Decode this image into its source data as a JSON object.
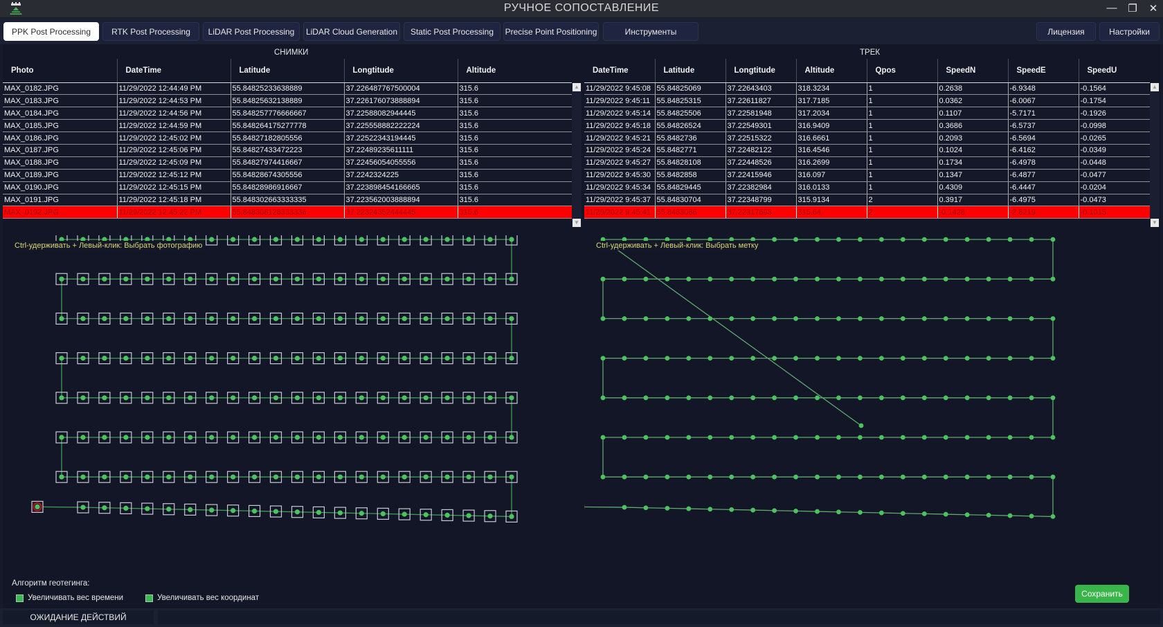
{
  "window": {
    "title": "РУЧНОЕ СОПОСТАВЛЕНИЕ",
    "minimize_icon": "minimize-icon",
    "restore_icon": "restore-icon",
    "close_icon": "close-icon"
  },
  "tabs": [
    {
      "label": "PPK Post Processing",
      "active": true
    },
    {
      "label": "RTK Post Processing",
      "active": false
    },
    {
      "label": "LiDAR Post Processing",
      "active": false
    },
    {
      "label": "LiDAR Cloud Generation",
      "active": false
    },
    {
      "label": "Static Post Processing",
      "active": false
    },
    {
      "label": "Precise Point Positioning",
      "active": false
    },
    {
      "label": "Инструменты",
      "active": false
    }
  ],
  "right_buttons": {
    "license": "Лицензия",
    "settings": "Настройки"
  },
  "photos_table": {
    "title": "СНИМКИ",
    "columns": [
      "Photo",
      "DateTime",
      "Latitude",
      "Longtitude",
      "Altitude"
    ],
    "rows": [
      [
        "MAX_0182.JPG",
        "11/29/2022 12:44:49 PM",
        "55.84825233638889",
        "37.226487767500004",
        "315.6"
      ],
      [
        "MAX_0183.JPG",
        "11/29/2022 12:44:53 PM",
        "55.84825632138889",
        "37.226176073888894",
        "315.6"
      ],
      [
        "MAX_0184.JPG",
        "11/29/2022 12:44:56 PM",
        "55.848257776666667",
        "37.22588082944445",
        "315.6"
      ],
      [
        "MAX_0185.JPG",
        "11/29/2022 12:44:59 PM",
        "55.848264175277778",
        "37.225558882222224",
        "315.6"
      ],
      [
        "MAX_0186.JPG",
        "11/29/2022 12:45:02 PM",
        "55.84827182805556",
        "37.22522343194445",
        "315.6"
      ],
      [
        "MAX_0187.JPG",
        "11/29/2022 12:45:06 PM",
        "55.84827433472223",
        "37.22489235611111",
        "315.6"
      ],
      [
        "MAX_0188.JPG",
        "11/29/2022 12:45:09 PM",
        "55.84827974416667",
        "37.22456054055556",
        "315.6"
      ],
      [
        "MAX_0189.JPG",
        "11/29/2022 12:45:12 PM",
        "55.84828674305556",
        "37.2242324225",
        "315.6"
      ],
      [
        "MAX_0190.JPG",
        "11/29/2022 12:45:15 PM",
        "55.84828986916667",
        "37.223898454166665",
        "315.6"
      ],
      [
        "MAX_0191.JPG",
        "11/29/2022 12:45:18 PM",
        "55.848302663333335",
        "37.223562003888894",
        "315.6"
      ],
      [
        "MAX_0192.JPG",
        "11/29/2022 12:45:22 PM",
        "55.848308128333336",
        "37.22324352444445",
        "315.6"
      ]
    ],
    "selected_row": 10
  },
  "track_table": {
    "title": "ТРЕК",
    "columns": [
      "DateTime",
      "Latitude",
      "Longtitude",
      "Altitude",
      "Qpos",
      "SpeedN",
      "SpeedE",
      "SpeedU"
    ],
    "rows": [
      [
        "11/29/2022 9:45:08",
        "55.84825069",
        "37.22643403",
        "318.3234",
        "1",
        "0.2638",
        "-6.9348",
        "-0.1564"
      ],
      [
        "11/29/2022 9:45:11",
        "55.84825315",
        "37.22611827",
        "317.7185",
        "1",
        "0.0362",
        "-6.0067",
        "-0.1754"
      ],
      [
        "11/29/2022 9:45:14",
        "55.84825506",
        "37.22581948",
        "317.2034",
        "1",
        "0.1107",
        "-5.7171",
        "-0.1926"
      ],
      [
        "11/29/2022 9:45:18",
        "55.84826524",
        "37.22549301",
        "316.9409",
        "1",
        "0.3686",
        "-6.5737",
        "-0.0998"
      ],
      [
        "11/29/2022 9:45:21",
        "55.8482736",
        "37.22515322",
        "316.6661",
        "1",
        "0.2093",
        "-6.5694",
        "-0.0265"
      ],
      [
        "11/29/2022 9:45:24",
        "55.8482771",
        "37.22482122",
        "316.4546",
        "1",
        "0.1024",
        "-6.4162",
        "-0.0349"
      ],
      [
        "11/29/2022 9:45:27",
        "55.84828108",
        "37.22448526",
        "316.2699",
        "1",
        "0.1734",
        "-6.4978",
        "-0.0448"
      ],
      [
        "11/29/2022 9:45:30",
        "55.8482858",
        "37.22415946",
        "316.097",
        "1",
        "0.1347",
        "-6.4877",
        "-0.0477"
      ],
      [
        "11/29/2022 9:45:34",
        "55.84829445",
        "37.22382984",
        "316.0133",
        "1",
        "0.4309",
        "-6.4447",
        "-0.0204"
      ],
      [
        "11/29/2022 9:45:37",
        "55.84830704",
        "37.22348799",
        "315.9134",
        "2",
        "0.3917",
        "-6.4975",
        "-0.0473"
      ],
      [
        "11/29/2022 9:45:41",
        "55.8483086",
        "37.22317693",
        "315.64",
        "2",
        "-0.1428",
        "-2.8219",
        "-0.1015"
      ]
    ],
    "selected_row": 10
  },
  "photo_map": {
    "hint": "Ctrl-удерживать + Левый-клик: Выбрать фотографию",
    "lines": 8,
    "points_per_line": 22,
    "marker_color": "#4cc35e",
    "line_color": "#3f9a52",
    "frame_color": "#c9c9d6",
    "selected_color": "#b3212b"
  },
  "track_map": {
    "hint": "Ctrl-удерживать + Левый-клик: Выбрать метку",
    "lines": 8,
    "points_per_line": 22,
    "marker_color": "#4cc35e",
    "line_color": "#5fa86e",
    "selected_color": "#b3212b"
  },
  "geotag": {
    "label": "Алгоритм геотегинга:",
    "options": [
      {
        "label": "Увеличивать вес времени",
        "checked": true
      },
      {
        "label": "Увеличивать вес координат",
        "checked": true
      }
    ]
  },
  "save_label": "Сохранить",
  "status": {
    "text": "ОЖИДАНИЕ ДЕЙСТВИЙ",
    "detail": ""
  },
  "icons": {
    "scroll_up": "▲",
    "scroll_down": "▼",
    "minimize": "—",
    "restore": "❐",
    "close": "✕"
  }
}
